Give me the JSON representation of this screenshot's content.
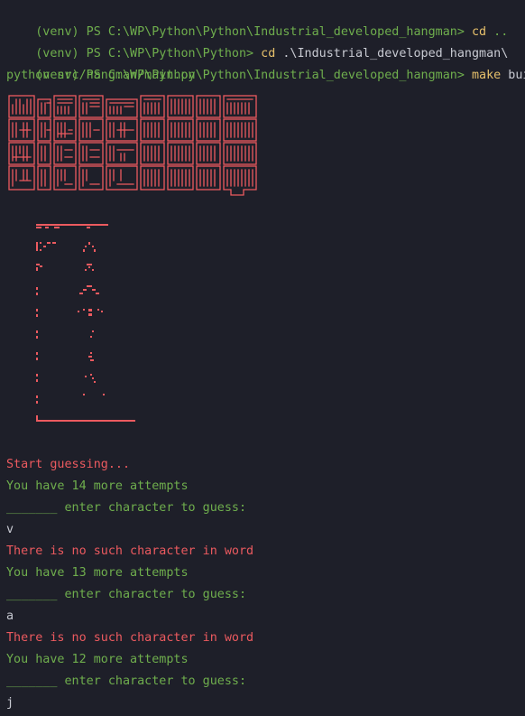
{
  "colors": {
    "background": "#1e1f29",
    "prompt_green": "#6fae4d",
    "command_yellow": "#e6c06b",
    "text": "#c8cad2",
    "error_red": "#ec5a5f"
  },
  "shell": {
    "lines": [
      {
        "prompt": "(venv) PS C:\\WP\\Python\\Python\\Industrial_developed_hangman> ",
        "command": "cd",
        "args": " .."
      },
      {
        "prompt": "(venv) PS C:\\WP\\Python\\Python> ",
        "command": "cd",
        "args": " .\\Industrial_developed_hangman\\"
      },
      {
        "prompt": "(venv) PS C:\\WP\\Python\\Python\\Industrial_developed_hangman> ",
        "command": "make",
        "args": " build"
      }
    ],
    "echo": "python src/hangman/main.py"
  },
  "game": {
    "start": "Start guessing...",
    "attempts_1": "You have 14 more attempts",
    "prompt_1": "_______ enter character to guess:",
    "input_1": "v",
    "error_1": "There is no such character in word",
    "attempts_2": "You have 13 more attempts",
    "prompt_2": "_______ enter character to guess:",
    "input_2": "a",
    "error_2": "There is no such character in word",
    "attempts_3": "You have 12 more attempts",
    "prompt_3": "_______ enter character to guess:",
    "input_3": "j"
  }
}
